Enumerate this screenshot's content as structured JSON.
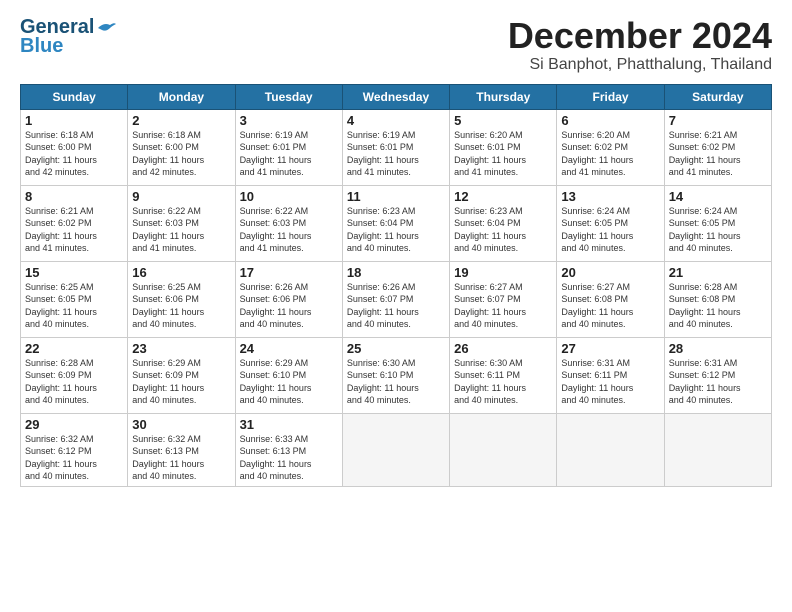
{
  "logo": {
    "line1": "General",
    "line2": "Blue"
  },
  "title": "December 2024",
  "subtitle": "Si Banphot, Phatthalung, Thailand",
  "days_header": [
    "Sunday",
    "Monday",
    "Tuesday",
    "Wednesday",
    "Thursday",
    "Friday",
    "Saturday"
  ],
  "weeks": [
    [
      {
        "day": "1",
        "info": "Sunrise: 6:18 AM\nSunset: 6:00 PM\nDaylight: 11 hours\nand 42 minutes."
      },
      {
        "day": "2",
        "info": "Sunrise: 6:18 AM\nSunset: 6:00 PM\nDaylight: 11 hours\nand 42 minutes."
      },
      {
        "day": "3",
        "info": "Sunrise: 6:19 AM\nSunset: 6:01 PM\nDaylight: 11 hours\nand 41 minutes."
      },
      {
        "day": "4",
        "info": "Sunrise: 6:19 AM\nSunset: 6:01 PM\nDaylight: 11 hours\nand 41 minutes."
      },
      {
        "day": "5",
        "info": "Sunrise: 6:20 AM\nSunset: 6:01 PM\nDaylight: 11 hours\nand 41 minutes."
      },
      {
        "day": "6",
        "info": "Sunrise: 6:20 AM\nSunset: 6:02 PM\nDaylight: 11 hours\nand 41 minutes."
      },
      {
        "day": "7",
        "info": "Sunrise: 6:21 AM\nSunset: 6:02 PM\nDaylight: 11 hours\nand 41 minutes."
      }
    ],
    [
      {
        "day": "8",
        "info": "Sunrise: 6:21 AM\nSunset: 6:02 PM\nDaylight: 11 hours\nand 41 minutes."
      },
      {
        "day": "9",
        "info": "Sunrise: 6:22 AM\nSunset: 6:03 PM\nDaylight: 11 hours\nand 41 minutes."
      },
      {
        "day": "10",
        "info": "Sunrise: 6:22 AM\nSunset: 6:03 PM\nDaylight: 11 hours\nand 41 minutes."
      },
      {
        "day": "11",
        "info": "Sunrise: 6:23 AM\nSunset: 6:04 PM\nDaylight: 11 hours\nand 40 minutes."
      },
      {
        "day": "12",
        "info": "Sunrise: 6:23 AM\nSunset: 6:04 PM\nDaylight: 11 hours\nand 40 minutes."
      },
      {
        "day": "13",
        "info": "Sunrise: 6:24 AM\nSunset: 6:05 PM\nDaylight: 11 hours\nand 40 minutes."
      },
      {
        "day": "14",
        "info": "Sunrise: 6:24 AM\nSunset: 6:05 PM\nDaylight: 11 hours\nand 40 minutes."
      }
    ],
    [
      {
        "day": "15",
        "info": "Sunrise: 6:25 AM\nSunset: 6:05 PM\nDaylight: 11 hours\nand 40 minutes."
      },
      {
        "day": "16",
        "info": "Sunrise: 6:25 AM\nSunset: 6:06 PM\nDaylight: 11 hours\nand 40 minutes."
      },
      {
        "day": "17",
        "info": "Sunrise: 6:26 AM\nSunset: 6:06 PM\nDaylight: 11 hours\nand 40 minutes."
      },
      {
        "day": "18",
        "info": "Sunrise: 6:26 AM\nSunset: 6:07 PM\nDaylight: 11 hours\nand 40 minutes."
      },
      {
        "day": "19",
        "info": "Sunrise: 6:27 AM\nSunset: 6:07 PM\nDaylight: 11 hours\nand 40 minutes."
      },
      {
        "day": "20",
        "info": "Sunrise: 6:27 AM\nSunset: 6:08 PM\nDaylight: 11 hours\nand 40 minutes."
      },
      {
        "day": "21",
        "info": "Sunrise: 6:28 AM\nSunset: 6:08 PM\nDaylight: 11 hours\nand 40 minutes."
      }
    ],
    [
      {
        "day": "22",
        "info": "Sunrise: 6:28 AM\nSunset: 6:09 PM\nDaylight: 11 hours\nand 40 minutes."
      },
      {
        "day": "23",
        "info": "Sunrise: 6:29 AM\nSunset: 6:09 PM\nDaylight: 11 hours\nand 40 minutes."
      },
      {
        "day": "24",
        "info": "Sunrise: 6:29 AM\nSunset: 6:10 PM\nDaylight: 11 hours\nand 40 minutes."
      },
      {
        "day": "25",
        "info": "Sunrise: 6:30 AM\nSunset: 6:10 PM\nDaylight: 11 hours\nand 40 minutes."
      },
      {
        "day": "26",
        "info": "Sunrise: 6:30 AM\nSunset: 6:11 PM\nDaylight: 11 hours\nand 40 minutes."
      },
      {
        "day": "27",
        "info": "Sunrise: 6:31 AM\nSunset: 6:11 PM\nDaylight: 11 hours\nand 40 minutes."
      },
      {
        "day": "28",
        "info": "Sunrise: 6:31 AM\nSunset: 6:12 PM\nDaylight: 11 hours\nand 40 minutes."
      }
    ],
    [
      {
        "day": "29",
        "info": "Sunrise: 6:32 AM\nSunset: 6:12 PM\nDaylight: 11 hours\nand 40 minutes."
      },
      {
        "day": "30",
        "info": "Sunrise: 6:32 AM\nSunset: 6:13 PM\nDaylight: 11 hours\nand 40 minutes."
      },
      {
        "day": "31",
        "info": "Sunrise: 6:33 AM\nSunset: 6:13 PM\nDaylight: 11 hours\nand 40 minutes."
      },
      {
        "day": "",
        "info": ""
      },
      {
        "day": "",
        "info": ""
      },
      {
        "day": "",
        "info": ""
      },
      {
        "day": "",
        "info": ""
      }
    ]
  ]
}
